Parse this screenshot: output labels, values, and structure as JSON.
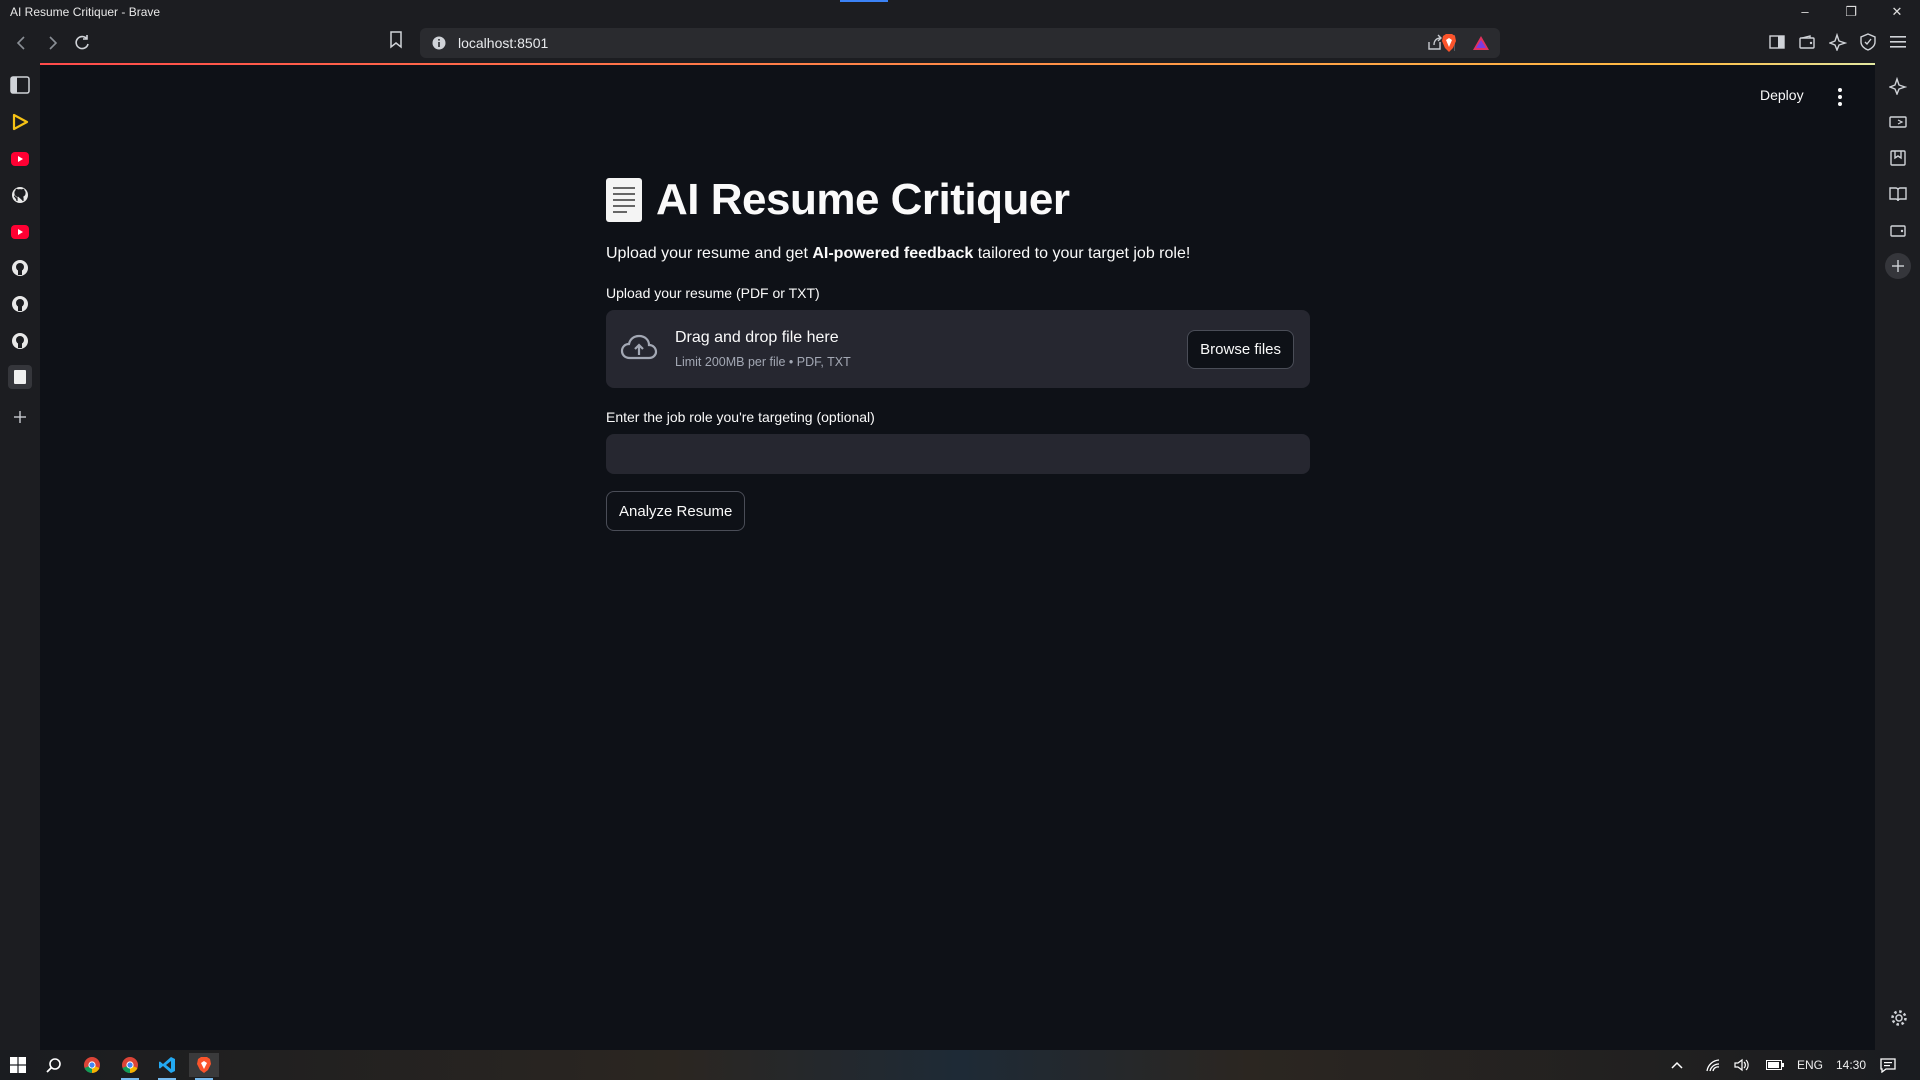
{
  "window": {
    "title": "AI Resume Critiquer - Brave"
  },
  "browser": {
    "url": "localhost:8501"
  },
  "app": {
    "deploy_label": "Deploy",
    "title": "AI Resume Critiquer",
    "subtitle_pre": "Upload your resume and get ",
    "subtitle_bold": "AI-powered feedback",
    "subtitle_post": " tailored to your target job role!",
    "upload_label": "Upload your resume (PDF or TXT)",
    "dropzone_title": "Drag and drop file here",
    "dropzone_limit": "Limit 200MB per file • PDF, TXT",
    "browse_label": "Browse files",
    "job_role_label": "Enter the job role you're targeting (optional)",
    "job_role_value": "",
    "analyze_label": "Analyze Resume"
  },
  "taskbar": {
    "language": "ENG",
    "time": "14:30"
  },
  "colors": {
    "background": "#0e1117",
    "widget": "#262730",
    "accent_red": "#ff4b4b"
  }
}
